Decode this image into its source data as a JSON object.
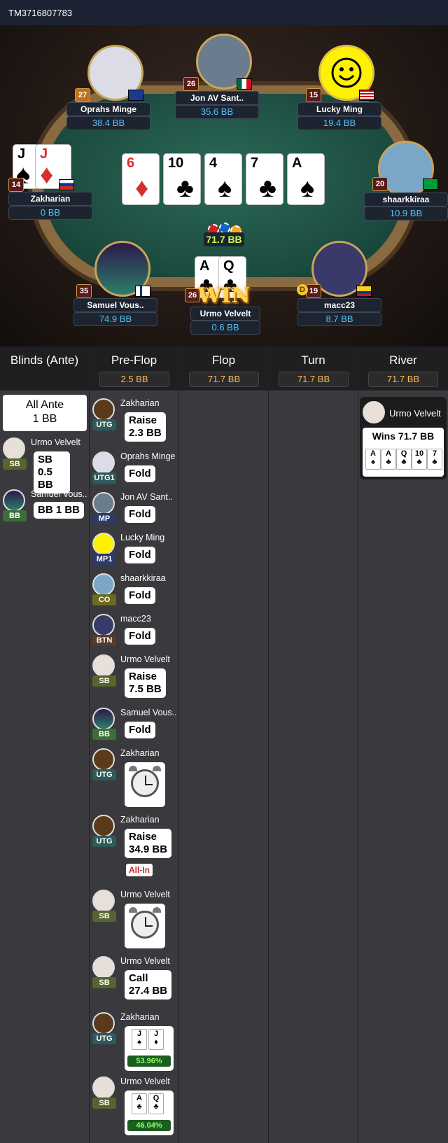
{
  "hand_id": "TM3716807783",
  "board": [
    {
      "rank": "6",
      "suit": "♦",
      "red": true
    },
    {
      "rank": "10",
      "suit": "♣",
      "red": false
    },
    {
      "rank": "4",
      "suit": "♠",
      "red": false
    },
    {
      "rank": "7",
      "suit": "♣",
      "red": false
    },
    {
      "rank": "A",
      "suit": "♠",
      "red": false
    }
  ],
  "pot": "71.7 BB",
  "win_label": "WIN",
  "dealer_label": "D",
  "seats": [
    {
      "name": "Oprahs Minge",
      "stack": "38.4 BB",
      "level": "27"
    },
    {
      "name": "Jon AV Sant..",
      "stack": "35.6 BB",
      "level": "26"
    },
    {
      "name": "Lucky Ming",
      "stack": "19.4 BB",
      "level": "15"
    },
    {
      "name": "Zakharian",
      "stack": "0 BB",
      "level": "14"
    },
    {
      "name": "shaarkkiraa",
      "stack": "10.9 BB",
      "level": "20"
    },
    {
      "name": "Samuel Vous..",
      "stack": "74.9 BB",
      "level": "35"
    },
    {
      "name": "Urmo Velvelt",
      "stack": "0.6 BB",
      "level": "26"
    },
    {
      "name": "macc23",
      "stack": "8.7 BB",
      "level": "19"
    }
  ],
  "hole_cards": {
    "zakharian": [
      {
        "rank": "J",
        "suit": "♠"
      },
      {
        "rank": "J",
        "suit": "♦"
      }
    ],
    "urmo": [
      {
        "rank": "A",
        "suit": "♣"
      },
      {
        "rank": "Q",
        "suit": "♣"
      }
    ]
  },
  "streets": {
    "blinds": {
      "title": "Blinds (Ante)",
      "all_ante": "All Ante",
      "ante_amt": "1 BB"
    },
    "preflop": {
      "title": "Pre-Flop",
      "pot": "2.5 BB"
    },
    "flop": {
      "title": "Flop",
      "pot": "71.7 BB"
    },
    "turn": {
      "title": "Turn",
      "pot": "71.7 BB"
    },
    "river": {
      "title": "River",
      "pot": "71.7 BB"
    }
  },
  "blind_actions": [
    {
      "name": "Urmo Velvelt",
      "pos": "SB",
      "l1": "SB",
      "l2": "0.5 BB"
    },
    {
      "name": "Samuel Vous..",
      "pos": "BB",
      "l1": "BB 1 BB",
      "l2": ""
    }
  ],
  "preflop_actions": [
    {
      "name": "Zakharian",
      "pos": "UTG",
      "l1": "Raise",
      "l2": "2.3 BB"
    },
    {
      "name": "Oprahs Minge",
      "pos": "UTG1",
      "l1": "Fold",
      "l2": ""
    },
    {
      "name": "Jon AV Sant..",
      "pos": "MP",
      "l1": "Fold",
      "l2": ""
    },
    {
      "name": "Lucky Ming",
      "pos": "MP1",
      "l1": "Fold",
      "l2": ""
    },
    {
      "name": "shaarkkiraa",
      "pos": "CO",
      "l1": "Fold",
      "l2": ""
    },
    {
      "name": "macc23",
      "pos": "BTN",
      "l1": "Fold",
      "l2": ""
    },
    {
      "name": "Urmo Velvelt",
      "pos": "SB",
      "l1": "Raise",
      "l2": "7.5 BB"
    },
    {
      "name": "Samuel Vous..",
      "pos": "BB",
      "l1": "Fold",
      "l2": ""
    },
    {
      "name": "Zakharian",
      "pos": "UTG",
      "l1": "",
      "l2": ""
    },
    {
      "name": "Zakharian",
      "pos": "UTG",
      "l1": "Raise",
      "l2": "34.9 BB"
    },
    {
      "name": "Urmo Velvelt",
      "pos": "SB",
      "l1": "",
      "l2": ""
    },
    {
      "name": "Urmo Velvelt",
      "pos": "SB",
      "l1": "Call",
      "l2": "27.4 BB"
    },
    {
      "name": "Zakharian",
      "pos": "UTG",
      "l1": "",
      "l2": ""
    },
    {
      "name": "Urmo Velvelt",
      "pos": "SB",
      "l1": "",
      "l2": ""
    }
  ],
  "all_in_label": "All-In",
  "equity": {
    "zakharian": "53.96%",
    "urmo": "46.04%"
  },
  "river_result": {
    "name": "Urmo Velvelt",
    "wins": "Wins 71.7 BB",
    "cards": [
      {
        "rank": "A",
        "suit": "♠"
      },
      {
        "rank": "A",
        "suit": "♣"
      },
      {
        "rank": "Q",
        "suit": "♣"
      },
      {
        "rank": "10",
        "suit": "♣"
      },
      {
        "rank": "7",
        "suit": "♣"
      }
    ]
  }
}
